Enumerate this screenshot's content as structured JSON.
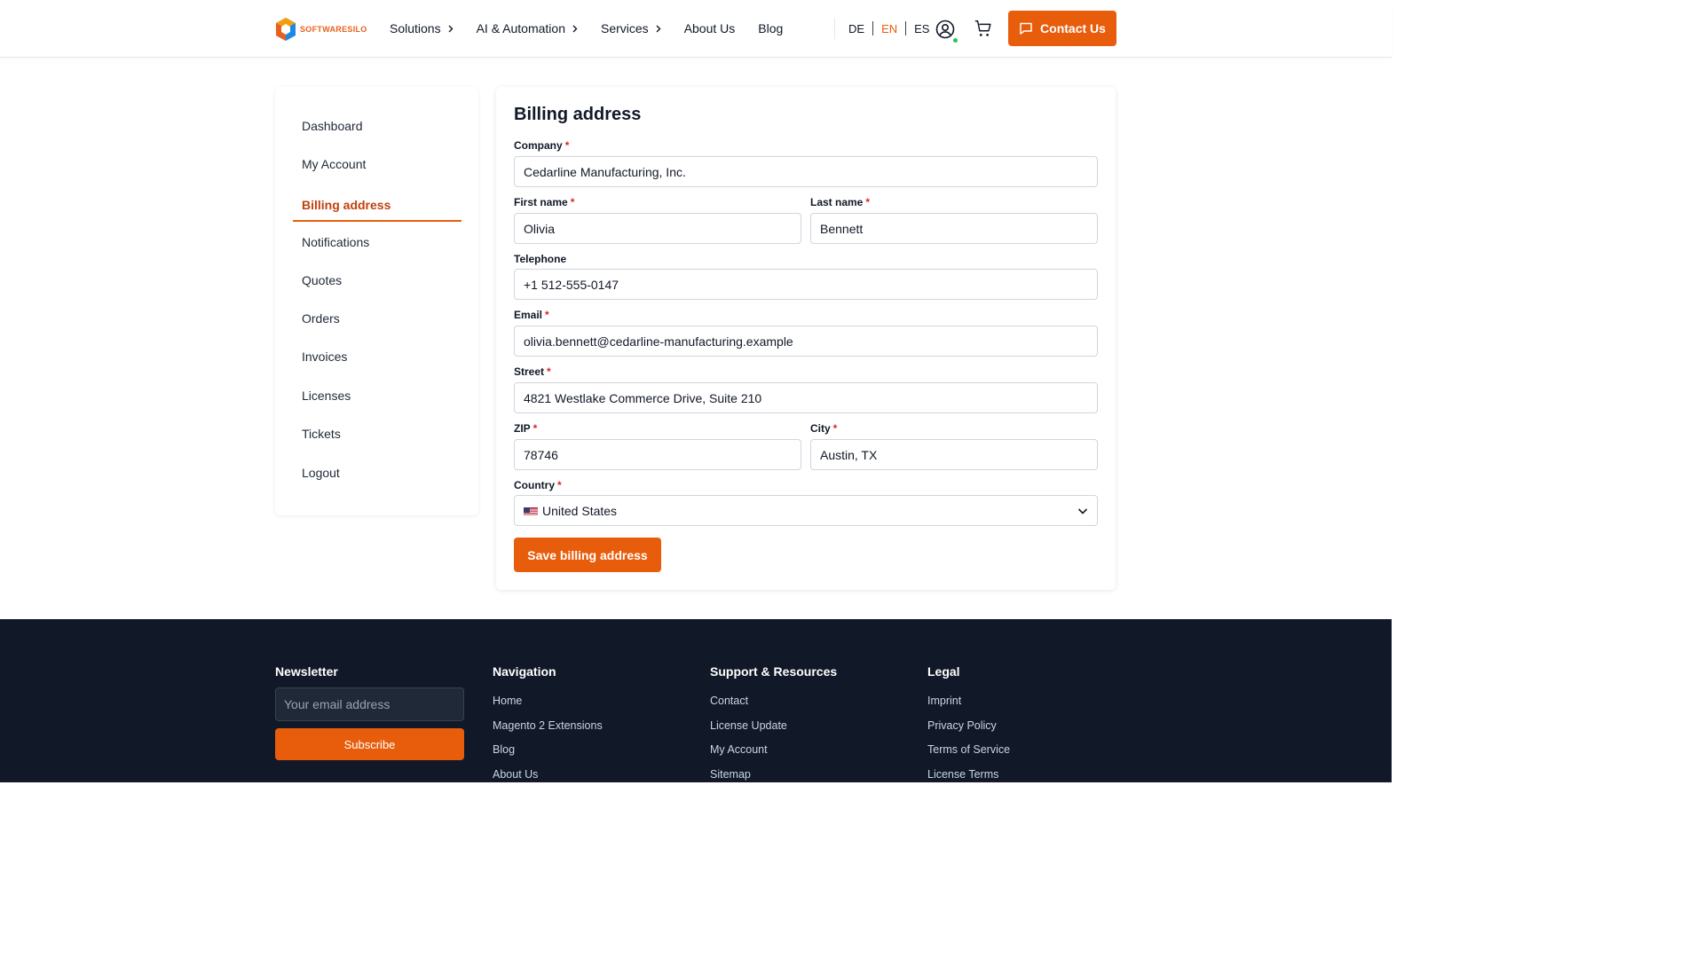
{
  "header": {
    "logo_text": "SOFTWARESILO",
    "nav": [
      {
        "label": "Solutions",
        "has_chevron": true
      },
      {
        "label": "AI & Automation",
        "has_chevron": true
      },
      {
        "label": "Services",
        "has_chevron": true
      },
      {
        "label": "About Us",
        "has_chevron": false
      },
      {
        "label": "Blog",
        "has_chevron": false
      }
    ],
    "languages": [
      "DE",
      "EN",
      "ES"
    ],
    "active_language": "EN",
    "contact_label": "Contact Us",
    "accent_color": "#e85d0c",
    "online_status_color": "#22c55e"
  },
  "sidebar": {
    "items": [
      {
        "label": "Dashboard"
      },
      {
        "label": "My Account"
      },
      {
        "label": "Billing address",
        "active": true
      },
      {
        "label": "Notifications"
      },
      {
        "label": "Quotes"
      },
      {
        "label": "Orders"
      },
      {
        "label": "Invoices"
      },
      {
        "label": "Licenses"
      },
      {
        "label": "Tickets"
      },
      {
        "label": "Logout"
      }
    ]
  },
  "form": {
    "title": "Billing address",
    "required_marker": "*",
    "company": {
      "label": "Company",
      "value": "Cedarline Manufacturing, Inc.",
      "required": true
    },
    "first_name": {
      "label": "First name",
      "value": "Olivia",
      "required": true
    },
    "last_name": {
      "label": "Last name",
      "value": "Bennett",
      "required": true
    },
    "telephone": {
      "label": "Telephone",
      "value": "+1 512-555-0147",
      "required": false
    },
    "email": {
      "label": "Email",
      "value": "olivia.bennett@cedarline-manufacturing.example",
      "required": true
    },
    "street": {
      "label": "Street",
      "value": "4821 Westlake Commerce Drive, Suite 210",
      "required": true
    },
    "zip": {
      "label": "ZIP",
      "value": "78746",
      "required": true
    },
    "city": {
      "label": "City",
      "value": "Austin, TX",
      "required": true
    },
    "country": {
      "label": "Country",
      "value": "United States",
      "flag_icon": "us-flag-icon",
      "required": true
    },
    "save_label": "Save billing address"
  },
  "footer": {
    "newsletter": {
      "heading": "Newsletter",
      "placeholder": "Your email address",
      "button_label": "Subscribe"
    },
    "navigation": {
      "heading": "Navigation",
      "links": [
        "Home",
        "Magento 2 Extensions",
        "Blog",
        "About Us"
      ]
    },
    "support": {
      "heading": "Support & Resources",
      "links": [
        "Contact",
        "License Update",
        "My Account",
        "Sitemap"
      ]
    },
    "legal": {
      "heading": "Legal",
      "links": [
        "Imprint",
        "Privacy Policy",
        "Terms of Service",
        "License Terms"
      ]
    },
    "background_color": "#111827"
  }
}
